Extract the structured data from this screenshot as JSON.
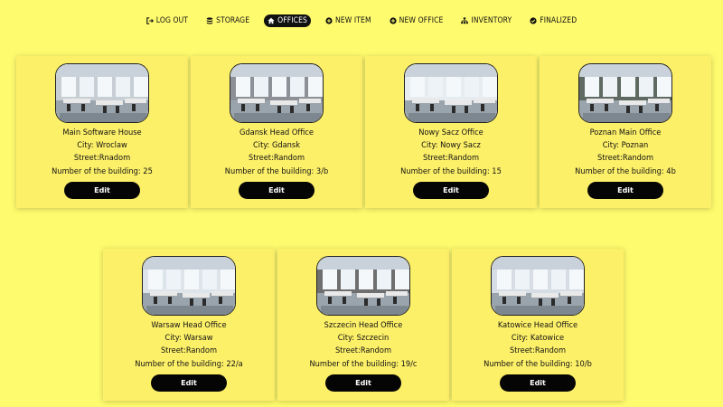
{
  "nav": [
    {
      "label": "LOG OUT",
      "icon": "logout-icon",
      "active": false
    },
    {
      "label": "STORAGE",
      "icon": "database-icon",
      "active": false
    },
    {
      "label": "OFFICES",
      "icon": "home-icon",
      "active": true
    },
    {
      "label": "NEW ITEM",
      "icon": "plus-circle-icon",
      "active": false
    },
    {
      "label": "NEW OFFICE",
      "icon": "plus-circle-icon",
      "active": false
    },
    {
      "label": "INVENTORY",
      "icon": "sitemap-icon",
      "active": false
    },
    {
      "label": "FINALIZED",
      "icon": "check-circle-icon",
      "active": false
    }
  ],
  "offices": [
    {
      "name": "Main Software House",
      "city": "City: Wroclaw",
      "street": "Street:Rnadom",
      "building": "Number of the building: 25",
      "edit": "Edit"
    },
    {
      "name": "Gdansk Head Office",
      "city": "City: Gdansk",
      "street": "Street:Random",
      "building": "Number of the building: 3/b",
      "edit": "Edit"
    },
    {
      "name": "Nowy Sacz Office",
      "city": "City: Nowy Sacz",
      "street": "Street:Random",
      "building": "Number of the building: 15",
      "edit": "Edit"
    },
    {
      "name": "Poznan Main Office",
      "city": "City: Poznan",
      "street": "Street:Random",
      "building": "Number of the building: 4b",
      "edit": "Edit"
    },
    {
      "name": "Warsaw Head Office",
      "city": "City: Warsaw",
      "street": "Street:Random",
      "building": "Number of the building: 22/a",
      "edit": "Edit"
    },
    {
      "name": "Szczecin Head Office",
      "city": "City: Szczecin",
      "street": "Street:Random",
      "building": "Number of the building: 19/c",
      "edit": "Edit"
    },
    {
      "name": "Katowice Head Office",
      "city": "City: Katowice",
      "street": "Street:Random",
      "building": "Number of the building: 10/b",
      "edit": "Edit"
    }
  ],
  "colors": {
    "background": "#fffb6e",
    "card": "#fdf069",
    "button": "#050505",
    "active_nav": "#111111"
  }
}
